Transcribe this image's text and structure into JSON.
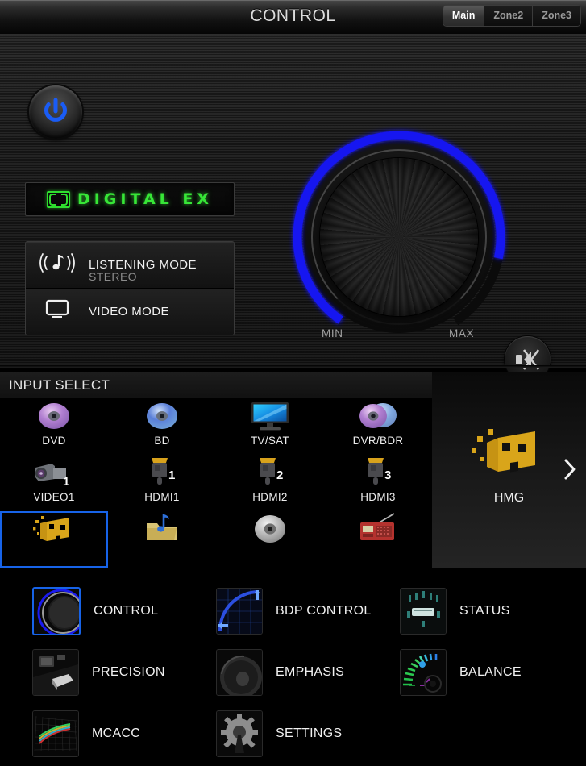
{
  "header": {
    "title": "CONTROL",
    "zones": [
      {
        "label": "Main",
        "active": true
      },
      {
        "label": "Zone2",
        "active": false
      },
      {
        "label": "Zone3",
        "active": false
      }
    ]
  },
  "control_panel": {
    "power_button": "power-on-off",
    "display": {
      "logo": "dolby-double-d",
      "text": "DIGITAL EX",
      "color": "#37e637"
    },
    "modes": [
      {
        "icon": "speaker-note-icon",
        "label": "LISTENING MODE",
        "value": "STEREO"
      },
      {
        "icon": "monitor-icon",
        "label": "VIDEO MODE",
        "value": ""
      }
    ],
    "volume": {
      "min_label": "MIN",
      "max_label": "MAX",
      "level_percent": 85,
      "arc_color": "#1a1aff"
    },
    "mute_button": "mute-icon"
  },
  "input_select": {
    "title": "INPUT SELECT",
    "items": [
      {
        "label": "DVD",
        "icon": "dvd-disc-icon",
        "selected": false
      },
      {
        "label": "BD",
        "icon": "bd-disc-icon",
        "selected": false
      },
      {
        "label": "TV/SAT",
        "icon": "television-icon",
        "selected": false
      },
      {
        "label": "DVR/BDR",
        "icon": "dual-disc-icon",
        "selected": false
      },
      {
        "label": "VIDEO1",
        "icon": "camcorder-1-icon",
        "selected": false
      },
      {
        "label": "HDMI1",
        "icon": "hdmi-plug-1-icon",
        "selected": false
      },
      {
        "label": "HDMI2",
        "icon": "hdmi-plug-2-icon",
        "selected": false
      },
      {
        "label": "HDMI3",
        "icon": "hdmi-plug-3-icon",
        "selected": false
      },
      {
        "label": "",
        "icon": "hmg-icon",
        "selected": true
      },
      {
        "label": "",
        "icon": "music-folder-icon",
        "selected": false
      },
      {
        "label": "",
        "icon": "cd-disc-icon",
        "selected": false
      },
      {
        "label": "",
        "icon": "radio-tuner-icon",
        "selected": false
      }
    ]
  },
  "hmg_panel": {
    "label": "HMG",
    "icon": "hmg-icon",
    "next_arrow": "chevron-right-icon"
  },
  "menu": {
    "items": [
      {
        "label": "CONTROL",
        "icon": "volume-knob-icon",
        "selected": true
      },
      {
        "label": "BDP CONTROL",
        "icon": "bdp-arc-icon",
        "selected": false
      },
      {
        "label": "STATUS",
        "icon": "status-panel-icon",
        "selected": false
      },
      {
        "label": "PRECISION",
        "icon": "precision-icon",
        "selected": false
      },
      {
        "label": "EMPHASIS",
        "icon": "woofer-icon",
        "selected": false
      },
      {
        "label": "BALANCE",
        "icon": "balance-fan-icon",
        "selected": false
      },
      {
        "label": "MCACC",
        "icon": "mcacc-grid-icon",
        "selected": false
      },
      {
        "label": "SETTINGS",
        "icon": "gear-icon",
        "selected": false
      }
    ]
  }
}
